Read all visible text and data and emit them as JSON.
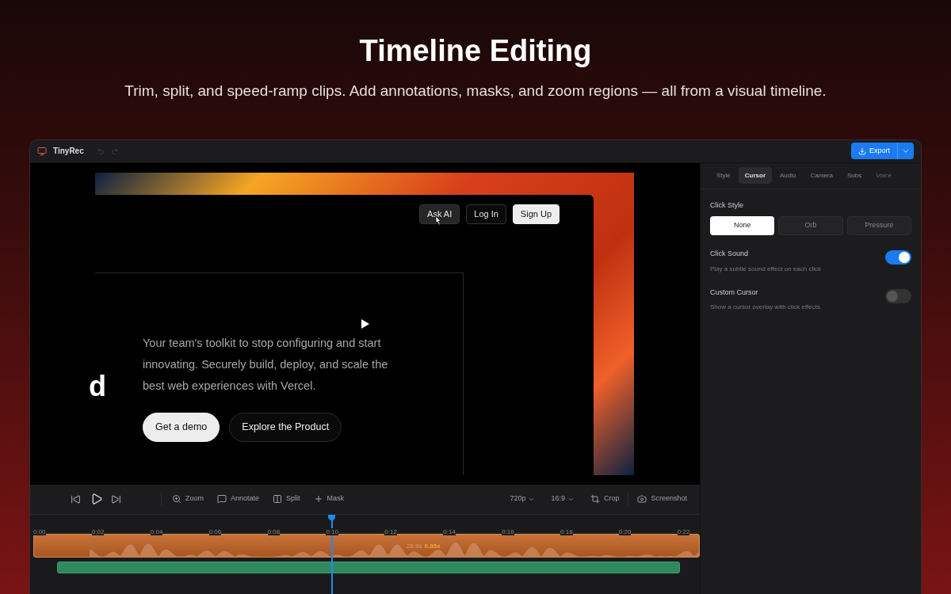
{
  "hero": {
    "title": "Timeline Editing",
    "subtitle": "Trim, split, and speed-ramp clips. Add annotations, masks, and zoom regions — all from a visual timeline."
  },
  "window": {
    "title": "TinyRec",
    "export": "Export"
  },
  "preview": {
    "nav": [
      {
        "label": "Ask AI",
        "kind": "ghost"
      },
      {
        "label": "Log In",
        "kind": "outline"
      },
      {
        "label": "Sign Up",
        "kind": "solid"
      }
    ],
    "heading_fragment": "d",
    "body": "Your team's toolkit to stop configuring and start innovating. Securely build, deploy, and scale the best web experiences with Vercel.",
    "ctas": [
      {
        "label": "Get a demo",
        "kind": "solid"
      },
      {
        "label": "Explore the Product",
        "kind": "outline"
      }
    ]
  },
  "toolbar": {
    "tools": [
      {
        "label": "Zoom",
        "kind": "zoom"
      },
      {
        "label": "Annotate",
        "kind": "annotate"
      },
      {
        "label": "Split",
        "kind": "split"
      },
      {
        "label": "Mask",
        "kind": "mask"
      }
    ],
    "resolution": "720p",
    "aspect": "16:9",
    "crop": "Crop",
    "screenshot": "Screenshot"
  },
  "timeline": {
    "ticks": [
      {
        "label": "0:00",
        "current": false
      },
      {
        "label": "0:02",
        "current": false
      },
      {
        "label": "0:04",
        "current": false
      },
      {
        "label": "0:06",
        "current": false
      },
      {
        "label": "0:08",
        "current": false
      },
      {
        "label": "0:10",
        "current": true
      },
      {
        "label": "0:12",
        "current": false
      },
      {
        "label": "0:14",
        "current": false
      },
      {
        "label": "0:16",
        "current": false
      },
      {
        "label": "0:18",
        "current": false
      },
      {
        "label": "0:20",
        "current": false
      },
      {
        "label": "0:22",
        "current": false
      }
    ],
    "clip": {
      "duration": "26.9s",
      "speed": "0.85x"
    }
  },
  "panel": {
    "tabs": [
      {
        "label": "Style",
        "selected": false,
        "disabled": false
      },
      {
        "label": "Cursor",
        "selected": true,
        "disabled": false
      },
      {
        "label": "Audio",
        "selected": false,
        "disabled": false
      },
      {
        "label": "Camera",
        "selected": false,
        "disabled": false
      },
      {
        "label": "Subs",
        "selected": false,
        "disabled": false
      },
      {
        "label": "Voice",
        "selected": false,
        "disabled": true
      }
    ],
    "click_style": {
      "label": "Click Style",
      "options": [
        {
          "label": "None",
          "selected": true
        },
        {
          "label": "Orb",
          "selected": false
        },
        {
          "label": "Pressure",
          "selected": false
        }
      ]
    },
    "toggles": [
      {
        "label": "Click Sound",
        "description": "Play a subtle sound effect on each click",
        "on": true
      },
      {
        "label": "Custom Cursor",
        "description": "Show a cursor overlay with click effects",
        "on": false
      }
    ]
  }
}
